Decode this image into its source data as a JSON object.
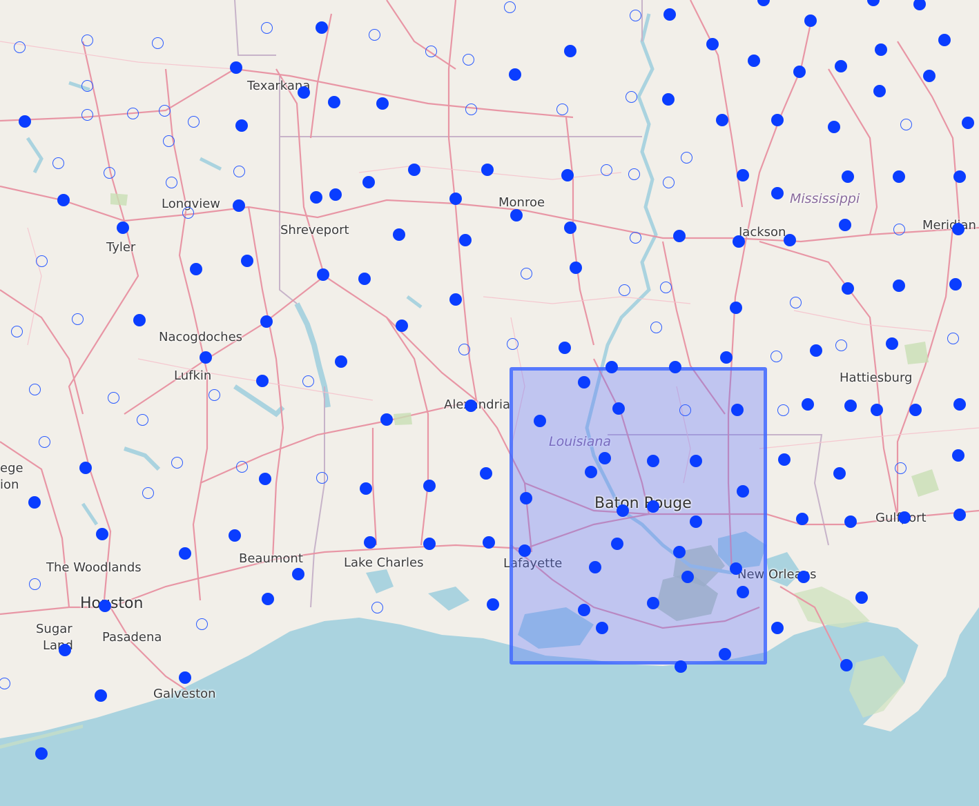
{
  "map": {
    "city_labels": [
      {
        "id": "texarkana",
        "text": "Texarkana"
      },
      {
        "id": "longview",
        "text": "Longview"
      },
      {
        "id": "tyler",
        "text": "Tyler"
      },
      {
        "id": "shreveport",
        "text": "Shreveport"
      },
      {
        "id": "monroe",
        "text": "Monroe"
      },
      {
        "id": "jackson",
        "text": "Jackson"
      },
      {
        "id": "meridian",
        "text": "Meridian"
      },
      {
        "id": "nacogdoches",
        "text": "Nacogdoches"
      },
      {
        "id": "lufkin",
        "text": "Lufkin"
      },
      {
        "id": "alexandria",
        "text": "Alexandria"
      },
      {
        "id": "hattiesburg",
        "text": "Hattiesburg"
      },
      {
        "id": "baton-rouge",
        "text": "Baton Rouge"
      },
      {
        "id": "gulfport",
        "text": "Gulfport"
      },
      {
        "id": "lafayette",
        "text": "Lafayette"
      },
      {
        "id": "lake-charles",
        "text": "Lake Charles"
      },
      {
        "id": "beaumont",
        "text": "Beaumont"
      },
      {
        "id": "the-woodlands",
        "text": "The Woodlands"
      },
      {
        "id": "houston",
        "text": "Houston"
      },
      {
        "id": "sugar",
        "text": "Sugar"
      },
      {
        "id": "land",
        "text": "Land"
      },
      {
        "id": "pasadena",
        "text": "Pasadena"
      },
      {
        "id": "galveston",
        "text": "Galveston"
      },
      {
        "id": "new-orleans",
        "text": "New Orleans"
      },
      {
        "id": "ege",
        "text": "ege"
      },
      {
        "id": "ion",
        "text": "ion"
      }
    ],
    "state_labels": [
      {
        "id": "mississippi",
        "text": "Mississippi"
      },
      {
        "id": "louisiana",
        "text": "Louisiana"
      }
    ]
  },
  "colors": {
    "land": "#f2efe9",
    "water": "#aad3df",
    "road": "#e892a2",
    "marker": "#0a3dff",
    "selection_fill": "rgba(88,110,255,0.32)",
    "selection_border": "#4069ff"
  },
  "stations": {
    "selected_count": 129,
    "unselected_count": 62
  }
}
